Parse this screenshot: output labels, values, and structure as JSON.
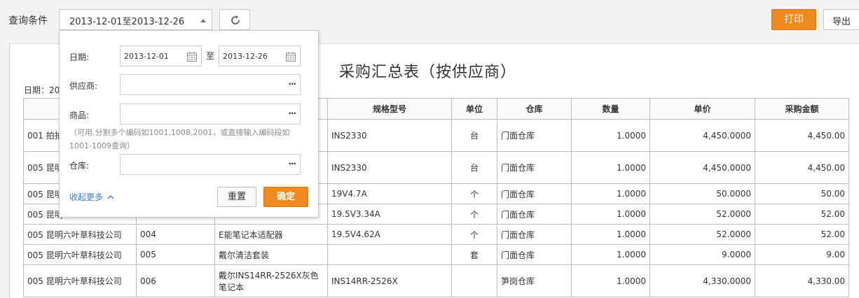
{
  "toolbar": {
    "query_label": "查询条件",
    "date_range": "2013-12-01至2013-12-26",
    "print_label": "打印",
    "export_label": "导出"
  },
  "report": {
    "title": "采购汇总表（按供应商）",
    "date_prefix": "日期：20",
    "columns": [
      "",
      "",
      "",
      "规格型号",
      "单位",
      "仓库",
      "数量",
      "单价",
      "采购金额"
    ],
    "rows": [
      [
        "001 拍拍",
        "",
        "",
        "INS2330",
        "台",
        "门面仓库",
        "1.0000",
        "4,450.0000",
        "4,450.00"
      ],
      [
        "005 昆明",
        "",
        "",
        "INS2330",
        "台",
        "门面仓库",
        "1.0000",
        "4,450.0000",
        "4,450.00"
      ],
      [
        "005 昆明",
        "",
        "",
        "19V4.7A",
        "个",
        "门面仓库",
        "1.0000",
        "50.0000",
        "50.00"
      ],
      [
        "005 昆明",
        "",
        "",
        "19.5V3.34A",
        "个",
        "门面仓库",
        "1.0000",
        "52.0000",
        "52.00"
      ],
      [
        "005 昆明六叶草科技公司",
        "004",
        "E能笔记本适配器",
        "19.5V4.62A",
        "个",
        "门面仓库",
        "1.0000",
        "52.0000",
        "52.00"
      ],
      [
        "005 昆明六叶草科技公司",
        "005",
        "戴尔清洁套装",
        "",
        "套",
        "门面仓库",
        "1.0000",
        "9.0000",
        "9.00"
      ],
      [
        "005 昆明六叶草科技公司",
        "006",
        "戴尔INS14RR-2526X灰色笔记本",
        "INS14RR-2526X",
        "",
        "笋岗仓库",
        "1.0000",
        "4,330.0000",
        "4,330.00"
      ]
    ]
  },
  "filter": {
    "date_label": "日期:",
    "start_date": "2013-12-01",
    "to_label": "至",
    "end_date": "2013-12-26",
    "supplier_label": "供应商:",
    "product_label": "商品:",
    "hint": "（可用,分割多个编码如1001,1008,2001，或直接输入编码段如1001-1009查询）",
    "warehouse_label": "仓库:",
    "collapse_label": "收起更多",
    "reset_label": "重置",
    "confirm_label": "确定",
    "more_glyph": "···"
  },
  "colors": {
    "accent": "#f08a20",
    "link": "#3a7bd5"
  },
  "icons": [
    "refresh-icon",
    "calendar-icon",
    "chevron-up-icon",
    "caret-up-icon"
  ]
}
